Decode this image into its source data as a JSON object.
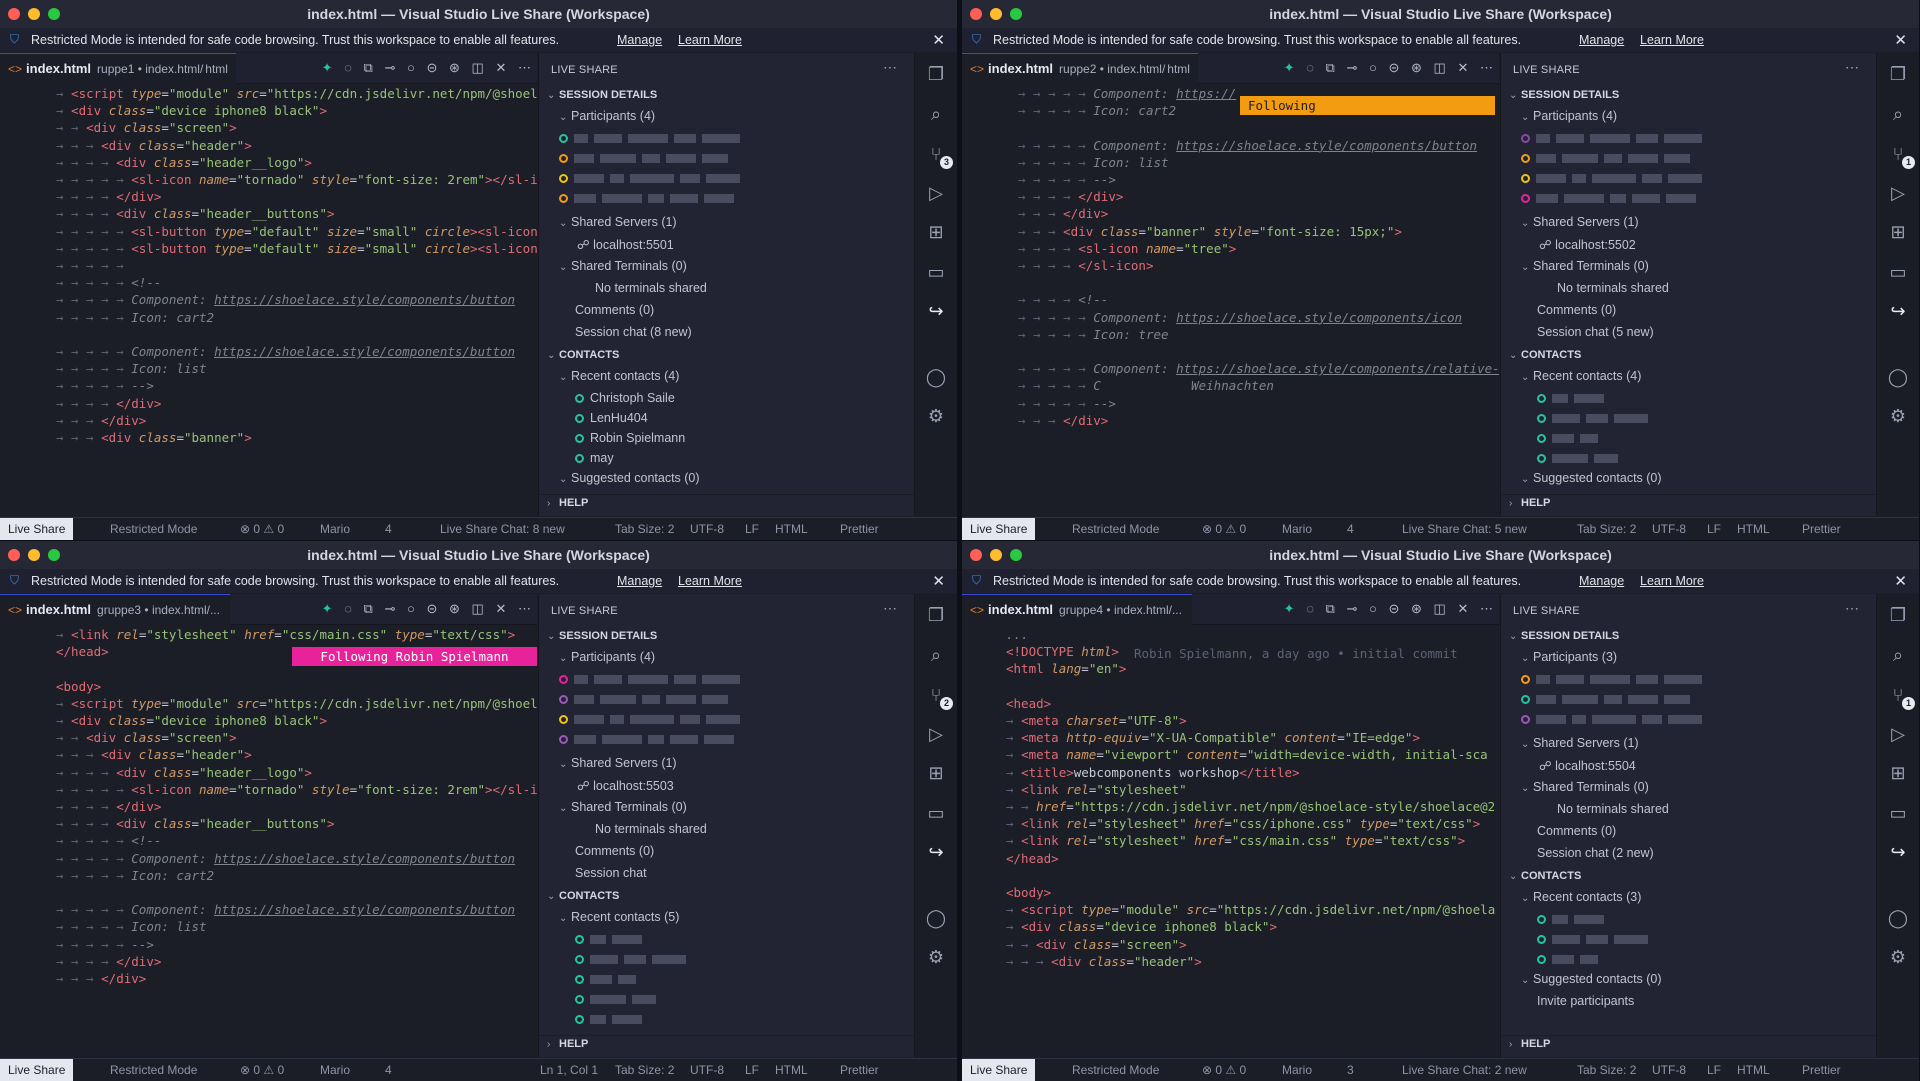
{
  "colors": {
    "accent": "#3b4bd0",
    "follow_orange": "#f39c12",
    "follow_pink": "#e8229b",
    "participant_green": "#27c49a"
  },
  "windows": [
    {
      "title": "index.html — Visual Studio Live Share (Workspace)",
      "restricted": {
        "text": "Restricted Mode is intended for safe code browsing. Trust this workspace to enable all features.",
        "manage": "Manage",
        "learn": "Learn More"
      },
      "tab": {
        "name": "index.html",
        "path": "ruppe1 • index.html/",
        "crumb": "html"
      },
      "panel": {
        "header": "LIVE SHARE",
        "session_details": "SESSION DETAILS",
        "participants": "Participants (4)",
        "shared_servers": "Shared Servers (1)",
        "server": "localhost:5501",
        "shared_terminals": "Shared Terminals (0)",
        "no_terminals": "No terminals shared",
        "comments": "Comments (0)",
        "chat": "Session chat (8 new)",
        "contacts": "CONTACTS",
        "recent": "Recent contacts (4)",
        "contact_list": [
          "Christoph Saile",
          "LenHu404",
          "Robin Spielmann",
          "may"
        ],
        "suggested": "Suggested contacts (0)",
        "help": "HELP"
      },
      "status": {
        "liveshare": "Live Share",
        "restricted": "Restricted Mode",
        "problems": "⊗ 0 ⚠ 0",
        "user": "Mario",
        "count": "4",
        "chat": "Live Share Chat: 8 new",
        "tab_size": "Tab Size: 2",
        "encoding": "UTF-8",
        "eol": "LF",
        "lang": "HTML",
        "prettier": "Prettier"
      }
    },
    {
      "title": "index.html — Visual Studio Live Share (Workspace)",
      "restricted": {
        "text": "Restricted Mode is intended for safe code browsing. Trust this workspace to enable all features.",
        "manage": "Manage",
        "learn": "Learn More"
      },
      "tab": {
        "name": "index.html",
        "path": "ruppe2 • index.html/",
        "crumb": "html"
      },
      "following": "Following",
      "panel": {
        "header": "LIVE SHARE",
        "session_details": "SESSION DETAILS",
        "participants": "Participants (4)",
        "shared_servers": "Shared Servers (1)",
        "server": "localhost:5502",
        "shared_terminals": "Shared Terminals (0)",
        "no_terminals": "No terminals shared",
        "comments": "Comments (0)",
        "chat": "Session chat (5 new)",
        "contacts": "CONTACTS",
        "recent": "Recent contacts (4)",
        "suggested": "Suggested contacts (0)",
        "help": "HELP"
      },
      "status": {
        "liveshare": "Live Share",
        "restricted": "Restricted Mode",
        "problems": "⊗ 0 ⚠ 0",
        "user": "Mario",
        "count": "4",
        "chat": "Live Share Chat: 5 new",
        "tab_size": "Tab Size: 2",
        "encoding": "UTF-8",
        "eol": "LF",
        "lang": "HTML",
        "prettier": "Prettier"
      }
    },
    {
      "title": "index.html — Visual Studio Live Share (Workspace)",
      "restricted": {
        "text": "Restricted Mode is intended for safe code browsing. Trust this workspace to enable all features.",
        "manage": "Manage",
        "learn": "Learn More"
      },
      "tab": {
        "name": "index.html",
        "path": "gruppe3 • index.html/...",
        "crumb": ""
      },
      "following": "Following Robin Spielmann",
      "panel": {
        "header": "LIVE SHARE",
        "session_details": "SESSION DETAILS",
        "participants": "Participants (4)",
        "shared_servers": "Shared Servers (1)",
        "server": "localhost:5503",
        "shared_terminals": "Shared Terminals (0)",
        "no_terminals": "No terminals shared",
        "comments": "Comments (0)",
        "chat": "Session chat",
        "contacts": "CONTACTS",
        "recent": "Recent contacts (5)",
        "help": "HELP"
      },
      "status": {
        "liveshare": "Live Share",
        "restricted": "Restricted Mode",
        "problems": "⊗ 0 ⚠ 0",
        "user": "Mario",
        "count": "4",
        "position": "Ln 1, Col 1",
        "tab_size": "Tab Size: 2",
        "encoding": "UTF-8",
        "eol": "LF",
        "lang": "HTML",
        "prettier": "Prettier"
      }
    },
    {
      "title": "index.html — Visual Studio Live Share (Workspace)",
      "restricted": {
        "text": "Restricted Mode is intended for safe code browsing. Trust this workspace to enable all features.",
        "manage": "Manage",
        "learn": "Learn More"
      },
      "tab": {
        "name": "index.html",
        "path": "gruppe4 • index.html/...",
        "crumb": ""
      },
      "blame": "Robin Spielmann, a day ago • initial commit",
      "panel": {
        "header": "LIVE SHARE",
        "session_details": "SESSION DETAILS",
        "participants": "Participants (3)",
        "shared_servers": "Shared Servers (1)",
        "server": "localhost:5504",
        "shared_terminals": "Shared Terminals (0)",
        "no_terminals": "No terminals shared",
        "comments": "Comments (0)",
        "chat": "Session chat (2 new)",
        "contacts": "CONTACTS",
        "recent": "Recent contacts (3)",
        "suggested": "Suggested contacts (0)",
        "invite": "Invite participants",
        "help": "HELP"
      },
      "status": {
        "liveshare": "Live Share",
        "restricted": "Restricted Mode",
        "problems": "⊗ 0 ⚠ 0",
        "user": "Mario",
        "count": "3",
        "chat": "Live Share Chat: 2 new",
        "tab_size": "Tab Size: 2",
        "encoding": "UTF-8",
        "eol": "LF",
        "lang": "HTML",
        "prettier": "Prettier"
      }
    }
  ],
  "code": {
    "w0": [
      {
        "i": 1,
        "h": "<span class=\"tg\">&lt;script</span> <span class=\"at\">type</span>=<span class=\"st\">\"module\"</span> <span class=\"at\">src</span>=<span class=\"st\">\"https://cdn.jsdelivr.net/npm/@shoela</span>"
      },
      {
        "i": 1,
        "h": "<span class=\"tg\">&lt;div</span> <span class=\"at\">class</span>=<span class=\"st\">\"device iphone8 black\"</span><span class=\"tg\">&gt;</span>"
      },
      {
        "i": 2,
        "h": "<span class=\"tg\">&lt;div</span> <span class=\"at\">class</span>=<span class=\"st\">\"screen\"</span><span class=\"tg\">&gt;</span>"
      },
      {
        "i": 3,
        "h": "<span class=\"tg\">&lt;div</span> <span class=\"at\">class</span>=<span class=\"st\">\"header\"</span><span class=\"tg\">&gt;</span>"
      },
      {
        "i": 4,
        "h": "<span class=\"tg\">&lt;div</span> <span class=\"at\">class</span>=<span class=\"st\">\"header__logo\"</span><span class=\"tg\">&gt;</span>"
      },
      {
        "i": 5,
        "h": "<span class=\"tg\">&lt;sl-icon</span> <span class=\"at\">name</span>=<span class=\"st\">\"tornado\"</span> <span class=\"at\">style</span>=<span class=\"st\">\"font-size: 2rem\"</span><span class=\"tg\">&gt;&lt;/sl-ic</span>"
      },
      {
        "i": 4,
        "h": "<span class=\"tg\">&lt;/div&gt;</span>"
      },
      {
        "i": 4,
        "h": "<span class=\"tg\">&lt;div</span> <span class=\"at\">class</span>=<span class=\"st\">\"header__buttons\"</span><span class=\"tg\">&gt;</span>"
      },
      {
        "i": 5,
        "h": "<span class=\"tg\">&lt;sl-button</span> <span class=\"at\">type</span>=<span class=\"st\">\"default\"</span> <span class=\"at\">size</span>=<span class=\"st\">\"small\"</span> <span class=\"at\">circle</span><span class=\"tg\">&gt;&lt;sl-icon</span>"
      },
      {
        "i": 5,
        "h": "<span class=\"tg\">&lt;sl-button</span> <span class=\"at\">type</span>=<span class=\"st\">\"default\"</span> <span class=\"at\">size</span>=<span class=\"st\">\"small\"</span> <span class=\"at\">circle</span><span class=\"tg\">&gt;&lt;sl-icon</span>"
      },
      {
        "i": 5,
        "h": ""
      },
      {
        "i": 5,
        "h": "<span class=\"cm\">&lt;!--</span>"
      },
      {
        "i": 5,
        "h": "<span class=\"cm\">Component: </span><span class=\"lk\">https://shoelace.style/components/button</span>"
      },
      {
        "i": 5,
        "h": "<span class=\"cm\">Icon: cart2</span>"
      },
      {
        "i": 0,
        "h": ""
      },
      {
        "i": 5,
        "h": "<span class=\"cm\">Component: </span><span class=\"lk\">https://shoelace.style/components/button</span>"
      },
      {
        "i": 5,
        "h": "<span class=\"cm\">Icon: list</span>"
      },
      {
        "i": 5,
        "h": "<span class=\"cm\">--&gt;</span>"
      },
      {
        "i": 4,
        "h": "<span class=\"tg\">&lt;/div&gt;</span>"
      },
      {
        "i": 3,
        "h": "<span class=\"tg\">&lt;/div&gt;</span>"
      },
      {
        "i": 3,
        "h": "<span class=\"tg\">&lt;div</span> <span class=\"at\">class</span>=<span class=\"st\">\"banner\"</span><span class=\"tg\">&gt;</span>"
      }
    ],
    "w1": [
      {
        "i": 5,
        "h": "<span class=\"cm\">Component: </span><span class=\"lk\">https://</span>"
      },
      {
        "i": 5,
        "h": "<span class=\"cm\">Icon: cart2</span>"
      },
      {
        "i": 0,
        "h": ""
      },
      {
        "i": 5,
        "h": "<span class=\"cm\">Component: </span><span class=\"lk\">https://shoelace.style/components/button</span>"
      },
      {
        "i": 5,
        "h": "<span class=\"cm\">Icon: list</span>"
      },
      {
        "i": 5,
        "h": "<span class=\"cm\">--&gt;</span>"
      },
      {
        "i": 4,
        "h": "<span class=\"tg\">&lt;/div&gt;</span>"
      },
      {
        "i": 3,
        "h": "<span class=\"tg\">&lt;/div&gt;</span>"
      },
      {
        "i": 3,
        "h": "<span class=\"tg\">&lt;div</span> <span class=\"at\">class</span>=<span class=\"st\">\"banner\"</span> <span class=\"at\">style</span>=<span class=\"st\">\"font-size: 15px;\"</span><span class=\"tg\">&gt;</span>"
      },
      {
        "i": 4,
        "h": "<span class=\"tg\">&lt;sl-icon</span> <span class=\"at\">name</span>=<span class=\"st\">\"tree\"</span><span class=\"tg\">&gt;</span>"
      },
      {
        "i": 4,
        "h": "<span class=\"tg\">&lt;/sl-icon&gt;</span>"
      },
      {
        "i": 0,
        "h": ""
      },
      {
        "i": 4,
        "h": "<span class=\"cm\">&lt;!--</span>"
      },
      {
        "i": 5,
        "h": "<span class=\"cm\">Component: </span><span class=\"lk\">https://shoelace.style/components/icon</span>"
      },
      {
        "i": 5,
        "h": "<span class=\"cm\">Icon: tree</span>"
      },
      {
        "i": 0,
        "h": ""
      },
      {
        "i": 5,
        "h": "<span class=\"cm\">Component: </span><span class=\"lk\">https://shoelace.style/components/relative-t</span>"
      },
      {
        "i": 5,
        "h": "<span class=\"cm\">C            Weihnachten</span>"
      },
      {
        "i": 5,
        "h": "<span class=\"cm\">--&gt;</span>"
      },
      {
        "i": 3,
        "h": "<span class=\"tg\">&lt;/div&gt;</span>"
      }
    ],
    "w2": [
      {
        "i": 1,
        "h": "<span class=\"tg\">&lt;link</span> <span class=\"at\">rel</span>=<span class=\"st\">\"stylesheet\"</span> <span class=\"at\">href</span>=<span class=\"st\">\"css/main.css\"</span> <span class=\"at\">type</span>=<span class=\"st\">\"text/css\"</span><span class=\"tg\">&gt;</span>"
      },
      {
        "i": 0,
        "h": "<span class=\"tg\">&lt;/head&gt;</span>"
      },
      {
        "i": 0,
        "h": ""
      },
      {
        "i": 0,
        "h": "<span class=\"tg\">&lt;body&gt;</span>"
      },
      {
        "i": 1,
        "h": "<span class=\"tg\">&lt;script</span> <span class=\"at\">type</span>=<span class=\"st\">\"module\"</span> <span class=\"at\">src</span>=<span class=\"st\">\"https://cdn.jsdelivr.net/npm/@shoela</span>"
      },
      {
        "i": 1,
        "h": "<span class=\"tg\">&lt;div</span> <span class=\"at\">class</span>=<span class=\"st\">\"device iphone8 black\"</span><span class=\"tg\">&gt;</span>"
      },
      {
        "i": 2,
        "h": "<span class=\"tg\">&lt;div</span> <span class=\"at\">class</span>=<span class=\"st\">\"screen\"</span><span class=\"tg\">&gt;</span>"
      },
      {
        "i": 3,
        "h": "<span class=\"tg\">&lt;div</span> <span class=\"at\">class</span>=<span class=\"st\">\"header\"</span><span class=\"tg\">&gt;</span>"
      },
      {
        "i": 4,
        "h": "<span class=\"tg\">&lt;div</span> <span class=\"at\">class</span>=<span class=\"st\">\"header__logo\"</span><span class=\"tg\">&gt;</span>"
      },
      {
        "i": 5,
        "h": "<span class=\"tg\">&lt;sl-icon</span> <span class=\"at\">name</span>=<span class=\"st\">\"tornado\"</span> <span class=\"at\">style</span>=<span class=\"st\">\"font-size: 2rem\"</span><span class=\"tg\">&gt;&lt;/sl-ic</span>"
      },
      {
        "i": 4,
        "h": "<span class=\"tg\">&lt;/div&gt;</span>"
      },
      {
        "i": 4,
        "h": "<span class=\"tg\">&lt;div</span> <span class=\"at\">class</span>=<span class=\"st\">\"header__buttons\"</span><span class=\"tg\">&gt;</span>"
      },
      {
        "i": 5,
        "h": "<span class=\"cm\">&lt;!--</span>"
      },
      {
        "i": 5,
        "h": "<span class=\"cm\">Component: </span><span class=\"lk\">https://shoelace.style/components/button</span>"
      },
      {
        "i": 5,
        "h": "<span class=\"cm\">Icon: cart2</span>"
      },
      {
        "i": 0,
        "h": ""
      },
      {
        "i": 5,
        "h": "<span class=\"cm\">Component: </span><span class=\"lk\">https://shoelace.style/components/button</span>"
      },
      {
        "i": 5,
        "h": "<span class=\"cm\">Icon: list</span>"
      },
      {
        "i": 5,
        "h": "<span class=\"cm\">--&gt;</span>"
      },
      {
        "i": 4,
        "h": "<span class=\"tg\">&lt;/div&gt;</span>"
      },
      {
        "i": 3,
        "h": "<span class=\"tg\">&lt;/div&gt;</span>"
      }
    ],
    "w3": [
      {
        "i": 0,
        "h": "<span class=\"cm\">...</span>"
      },
      {
        "i": 0,
        "h": "<span class=\"tg\">&lt;!DOCTYPE</span> <span class=\"at\">html</span><span class=\"tg\">&gt;</span>"
      },
      {
        "i": 0,
        "h": "<span class=\"tg\">&lt;html</span> <span class=\"at\">lang</span>=<span class=\"st\">\"en\"</span><span class=\"tg\">&gt;</span>"
      },
      {
        "i": 0,
        "h": ""
      },
      {
        "i": 0,
        "h": "<span class=\"tg\">&lt;head&gt;</span>"
      },
      {
        "i": 1,
        "h": "<span class=\"tg\">&lt;meta</span> <span class=\"at\">charset</span>=<span class=\"st\">\"UTF-8\"</span><span class=\"tg\">&gt;</span>"
      },
      {
        "i": 1,
        "h": "<span class=\"tg\">&lt;meta</span> <span class=\"at\">http-equiv</span>=<span class=\"st\">\"X-UA-Compatible\"</span> <span class=\"at\">content</span>=<span class=\"st\">\"IE=edge\"</span><span class=\"tg\">&gt;</span>"
      },
      {
        "i": 1,
        "h": "<span class=\"tg\">&lt;meta</span> <span class=\"at\">name</span>=<span class=\"st\">\"viewport\"</span> <span class=\"at\">content</span>=<span class=\"st\">\"width=device-width, initial-sca</span>"
      },
      {
        "i": 1,
        "h": "<span class=\"tg\">&lt;title&gt;</span>webcomponents workshop<span class=\"tg\">&lt;/title&gt;</span>"
      },
      {
        "i": 1,
        "h": "<span class=\"tg\">&lt;link</span> <span class=\"at\">rel</span>=<span class=\"st\">\"stylesheet\"</span>"
      },
      {
        "i": 2,
        "h": "<span class=\"at\">href</span>=<span class=\"st\">\"https://cdn.jsdelivr.net/npm/@shoelace-style/shoelace@2</span>"
      },
      {
        "i": 1,
        "h": "<span class=\"tg\">&lt;link</span> <span class=\"at\">rel</span>=<span class=\"st\">\"stylesheet\"</span> <span class=\"at\">href</span>=<span class=\"st\">\"css/iphone.css\"</span> <span class=\"at\">type</span>=<span class=\"st\">\"text/css\"</span><span class=\"tg\">&gt;</span>"
      },
      {
        "i": 1,
        "h": "<span class=\"tg\">&lt;link</span> <span class=\"at\">rel</span>=<span class=\"st\">\"stylesheet\"</span> <span class=\"at\">href</span>=<span class=\"st\">\"css/main.css\"</span> <span class=\"at\">type</span>=<span class=\"st\">\"text/css\"</span><span class=\"tg\">&gt;</span>"
      },
      {
        "i": 0,
        "h": "<span class=\"tg\">&lt;/head&gt;</span>"
      },
      {
        "i": 0,
        "h": ""
      },
      {
        "i": 0,
        "h": "<span class=\"tg\">&lt;body&gt;</span>"
      },
      {
        "i": 1,
        "h": "<span class=\"tg\">&lt;script</span> <span class=\"at\">type</span>=<span class=\"st\">\"module\"</span> <span class=\"at\">src</span>=<span class=\"st\">\"https://cdn.jsdelivr.net/npm/@shoela</span>"
      },
      {
        "i": 1,
        "h": "<span class=\"tg\">&lt;div</span> <span class=\"at\">class</span>=<span class=\"st\">\"device iphone8 black\"</span><span class=\"tg\">&gt;</span>"
      },
      {
        "i": 2,
        "h": "<span class=\"tg\">&lt;div</span> <span class=\"at\">class</span>=<span class=\"st\">\"screen\"</span><span class=\"tg\">&gt;</span>"
      },
      {
        "i": 3,
        "h": "<span class=\"tg\">&lt;div</span> <span class=\"at\">class</span>=<span class=\"st\">\"header\"</span><span class=\"tg\">&gt;</span>"
      }
    ]
  }
}
